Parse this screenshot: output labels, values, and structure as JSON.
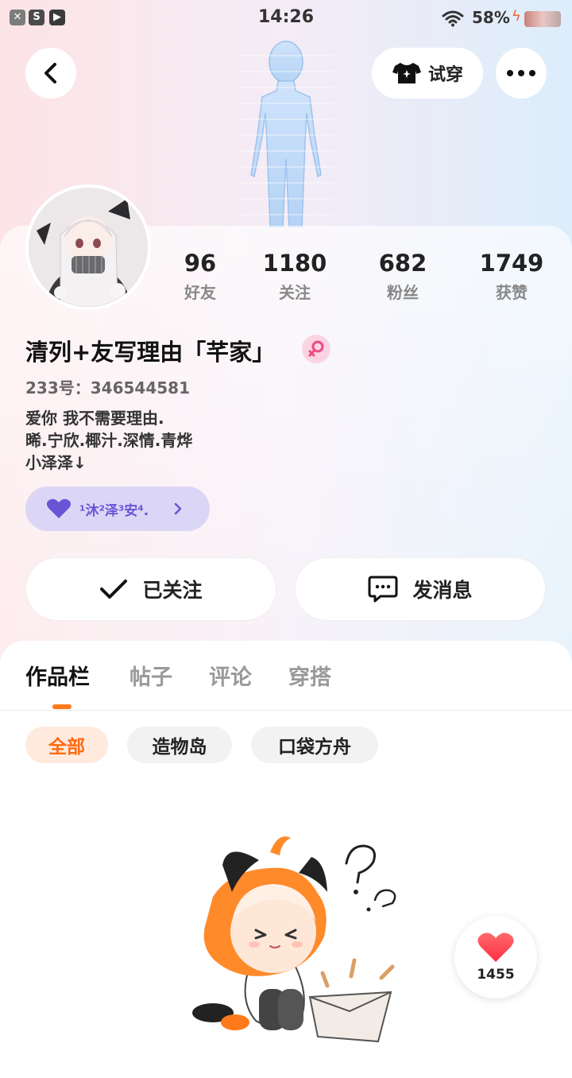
{
  "status_bar": {
    "time": "14:26",
    "battery": "58%",
    "left_icons": [
      "close-box-icon",
      "s-box-icon",
      "play-box-icon"
    ]
  },
  "header": {
    "tryon_label": "试穿"
  },
  "stats": [
    {
      "value": "96",
      "label": "好友"
    },
    {
      "value": "1180",
      "label": "关注"
    },
    {
      "value": "682",
      "label": "粉丝"
    },
    {
      "value": "1749",
      "label": "获赞"
    }
  ],
  "profile": {
    "nickname": "清列+友写理由「芊家」",
    "uid": "233号：346544581",
    "bio_lines": [
      "爱你 我不需要理由.",
      "晞.宁欣.椰汁.深情.青烨",
      "小泽泽↓"
    ],
    "relation": "¹沐²泽³安⁴."
  },
  "actions": {
    "follow_label": "已关注",
    "message_label": "发消息"
  },
  "tabs": [
    {
      "label": "作品栏",
      "active": true
    },
    {
      "label": "帖子",
      "active": false
    },
    {
      "label": "评论",
      "active": false
    },
    {
      "label": "穿搭",
      "active": false
    }
  ],
  "chips": [
    {
      "label": "全部",
      "active": true
    },
    {
      "label": "造物岛",
      "active": false
    },
    {
      "label": "口袋方舟",
      "active": false
    }
  ],
  "like_fab": {
    "count": "1455"
  },
  "colors": {
    "accent": "#ff7a1a",
    "relation_text": "#6a54d6",
    "relation_bg": "#dcd6f6",
    "gender_bg": "#fbd4e2",
    "heart": "#ff3d4d"
  }
}
